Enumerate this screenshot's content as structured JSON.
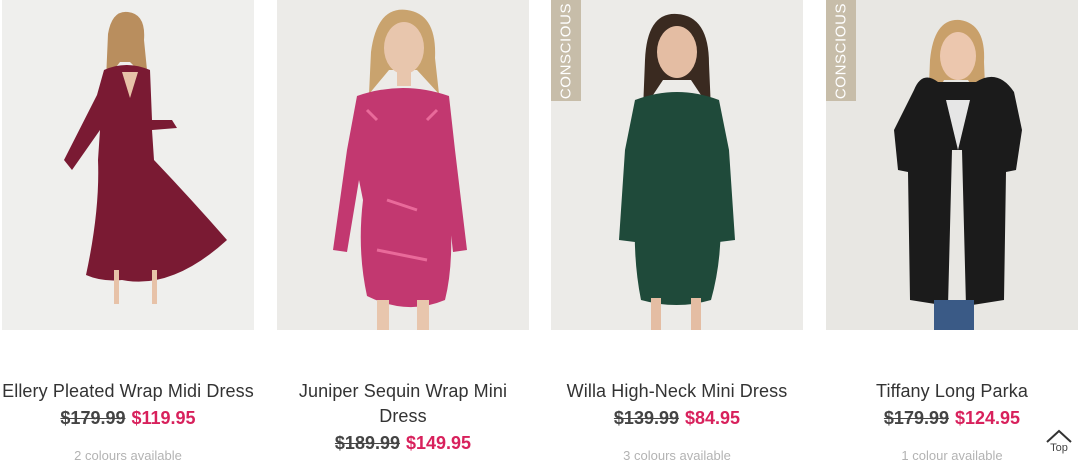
{
  "products": [
    {
      "name": "Ellery Pleated Wrap Midi Dress",
      "was_price": "$179.99",
      "now_price": "$119.95",
      "colours": "2 colours available",
      "badge": "",
      "image_colors": {
        "bg": "#efefed",
        "garment": "#7a1a33",
        "skin": "#e7c2a8",
        "hair": "#b98e5e"
      }
    },
    {
      "name": "Juniper Sequin Wrap Mini Dress",
      "was_price": "$189.99",
      "now_price": "$149.95",
      "colours": "",
      "badge": "",
      "image_colors": {
        "bg": "#ecebe8",
        "garment": "#c23870",
        "skin": "#e8c6ad",
        "hair": "#c9a36e"
      }
    },
    {
      "name": "Willa High-Neck Mini Dress",
      "was_price": "$139.99",
      "now_price": "$84.95",
      "colours": "3 colours available",
      "badge": "CONSCIOUS",
      "image_colors": {
        "bg": "#ecebe8",
        "garment": "#1f4a3a",
        "skin": "#e4bda3",
        "hair": "#3a2a20"
      }
    },
    {
      "name": "Tiffany Long Parka",
      "was_price": "$179.99",
      "now_price": "$124.95",
      "colours": "1 colour available",
      "badge": "CONSCIOUS",
      "image_colors": {
        "bg": "#e8e7e3",
        "garment": "#1b1b1b",
        "skin": "#ecc7ae",
        "hair": "#c9a06a"
      }
    }
  ],
  "back_to_top": {
    "label": "Top",
    "icon": "chevron-up-icon"
  },
  "colors": {
    "sale_price": "#d8215c",
    "badge_bg": "#c7bda9"
  }
}
